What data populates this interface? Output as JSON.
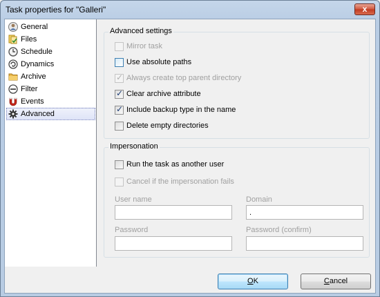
{
  "window": {
    "title": "Task properties for \"Galleri\"",
    "close_glyph": "x"
  },
  "tree": {
    "items": [
      {
        "label": "General",
        "icon": "user-icon"
      },
      {
        "label": "Files",
        "icon": "files-icon"
      },
      {
        "label": "Schedule",
        "icon": "clock-icon"
      },
      {
        "label": "Dynamics",
        "icon": "dynamics-icon"
      },
      {
        "label": "Archive",
        "icon": "folder-icon"
      },
      {
        "label": "Filter",
        "icon": "filter-icon"
      },
      {
        "label": "Events",
        "icon": "magnet-icon"
      },
      {
        "label": "Advanced",
        "icon": "gear-icon",
        "selected": true
      }
    ]
  },
  "advanced": {
    "group_label": "Advanced settings",
    "options": [
      {
        "label": "Mirror task",
        "checked": false,
        "enabled": false
      },
      {
        "label": "Use absolute paths",
        "checked": false,
        "enabled": true
      },
      {
        "label": "Always create top parent directory",
        "checked": true,
        "enabled": false
      },
      {
        "label": "Clear archive attribute",
        "checked": true,
        "enabled": true
      },
      {
        "label": "Include backup type in the name",
        "checked": true,
        "enabled": true
      },
      {
        "label": "Delete empty directories",
        "checked": false,
        "enabled": true
      }
    ]
  },
  "impersonation": {
    "group_label": "Impersonation",
    "run_as_label": "Run the task as another user",
    "cancel_label": "Cancel if the impersonation fails",
    "username_label": "User name",
    "username_value": "",
    "domain_label": "Domain",
    "domain_value": ".",
    "password_label": "Password",
    "password_value": "",
    "password_confirm_label": "Password (confirm)",
    "password_confirm_value": ""
  },
  "buttons": {
    "ok_mnemonic": "O",
    "ok_rest": "K",
    "cancel_mnemonic": "C",
    "cancel_rest": "ancel"
  },
  "colors": {
    "accent": "#3c7fb1",
    "selection_border": "#6f7ab8"
  }
}
